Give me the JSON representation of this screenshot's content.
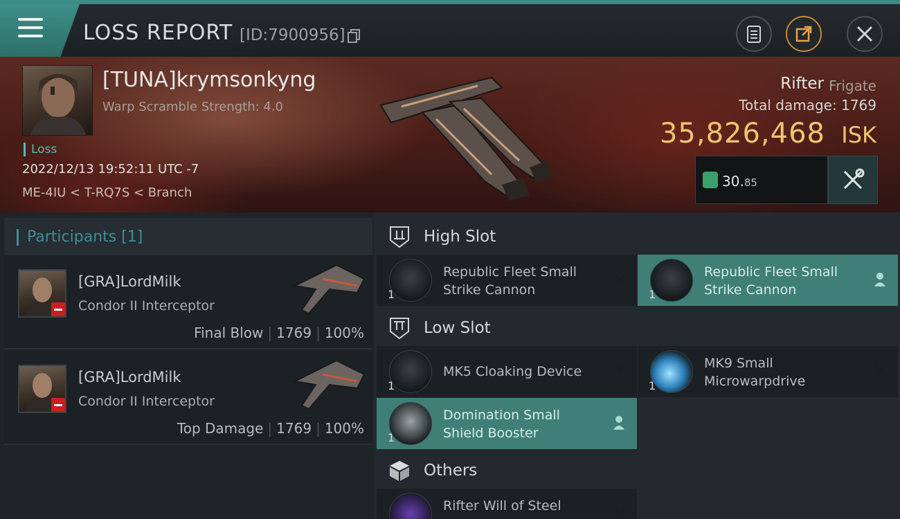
{
  "header": {
    "title": "LOSS REPORT",
    "report_id": "[ID:7900956]",
    "icons": [
      "menu-icon",
      "copy-icon",
      "clipboard-icon",
      "share-icon",
      "close-icon"
    ]
  },
  "victim": {
    "name": "[TUNA]krymsonkyng",
    "warp_scramble": "Warp Scramble Strength: 4.0",
    "status": "Loss",
    "datetime": "2022/12/13 19:52:11 UTC -7",
    "location": "ME-4IU < T-RQ7S < Branch",
    "ship_name": "Rifter",
    "ship_class": "Frigate",
    "total_damage_label": "Total damage:",
    "total_damage": "1769",
    "isk_value": "35,826,468",
    "isk_unit": "ISK",
    "metric_main": "30.",
    "metric_decimal": "85"
  },
  "participants": {
    "title": "Participants [1]",
    "rows": [
      {
        "name": "[GRA]LordMilk",
        "ship": "Condor II Interceptor",
        "label": "Final Blow",
        "damage": "1769",
        "percent": "100%"
      },
      {
        "name": "[GRA]LordMilk",
        "ship": "Condor II Interceptor",
        "label": "Top Damage",
        "damage": "1769",
        "percent": "100%"
      }
    ]
  },
  "slots": {
    "high_label": "High Slot",
    "low_label": "Low Slot",
    "others_label": "Others",
    "high": [
      {
        "qty": "1",
        "line1": "Republic Fleet Small",
        "line2": "Strike Cannon",
        "state": "destroyed"
      },
      {
        "qty": "1",
        "line1": "Republic Fleet Small",
        "line2": "Strike Cannon",
        "state": "dropped"
      }
    ],
    "low": [
      {
        "qty": "1",
        "line1": "MK5 Cloaking Device",
        "line2": "",
        "state": "destroyed"
      },
      {
        "qty": "1",
        "line1": "MK9 Small",
        "line2": "Microwarpdrive",
        "state": "destroyed"
      },
      {
        "qty": "1",
        "line1": "Domination Small",
        "line2": "Shield Booster",
        "state": "dropped"
      }
    ],
    "others": [
      {
        "qty": "1",
        "line1": "Rifter Will of Steel",
        "line2": "",
        "state": "destroyed"
      }
    ]
  },
  "colors": {
    "accent": "#3f7f77",
    "isk": "#f0c56f",
    "loss": "#4ec3b0",
    "danger": "#c8201f"
  }
}
